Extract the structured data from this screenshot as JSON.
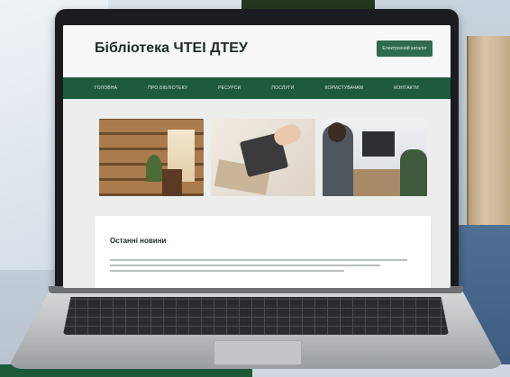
{
  "site": {
    "title": "Бібліотека ЧТЕІ ДТЕУ",
    "header_button": "Електронний каталог"
  },
  "nav": {
    "items": [
      "ГОЛОВНА",
      "ПРО БІБЛІОТЕКУ",
      "РЕСУРСИ",
      "ПОСЛУГИ",
      "КОРИСТУВАЧАМ",
      "КОНТАКТИ"
    ]
  },
  "news": {
    "heading": "Останні новини"
  }
}
